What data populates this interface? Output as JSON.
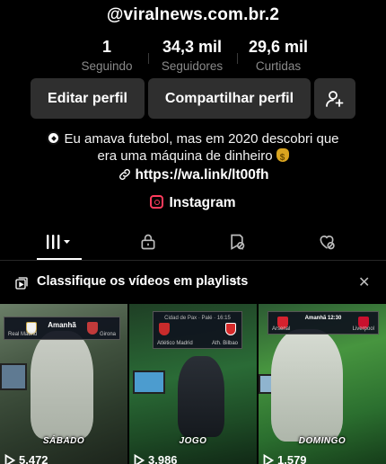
{
  "profile": {
    "username": "@viralnews.com.br.2"
  },
  "stats": [
    {
      "value": "1",
      "label": "Seguindo"
    },
    {
      "value": "34,3 mil",
      "label": "Seguidores"
    },
    {
      "value": "29,6 mil",
      "label": "Curtidas"
    }
  ],
  "actions": {
    "edit_label": "Editar perfil",
    "share_label": "Compartilhar perfil",
    "add_friend_icon": "add-user-icon"
  },
  "bio": {
    "line1": "Eu amava futebol, mas em 2020 descobri que",
    "line2": "era uma máquina de dinheiro",
    "link": "https://wa.link/lt00fh",
    "instagram_label": "Instagram"
  },
  "tabs": [
    {
      "name": "videos",
      "icon": "grid-icon",
      "active": true
    },
    {
      "name": "private",
      "icon": "lock-icon",
      "active": false
    },
    {
      "name": "favorites",
      "icon": "bookmark-hidden-icon",
      "active": false
    },
    {
      "name": "liked",
      "icon": "heart-hidden-icon",
      "active": false
    }
  ],
  "playlist_banner": {
    "text": "Classifique os vídeos em playlists"
  },
  "videos": [
    {
      "caption": "SÁBADO",
      "views": "5.472",
      "scoreboard": {
        "center": "Amanhã",
        "left": "Real Madrid",
        "right": "Girona"
      }
    },
    {
      "caption": "JOGO",
      "views": "3.986",
      "scoreboard": {
        "center": "Cidad de Pax · Palé · 16:15",
        "left": "Atlético Madrid",
        "right": "Ath. Bilbao"
      }
    },
    {
      "caption": "DOMINGO",
      "views": "1.579",
      "scoreboard": {
        "center": "Amanhã 12:30",
        "left": "Arsenal",
        "right": "Liverpool"
      }
    }
  ],
  "colors": {
    "background": "#000000",
    "button_bg": "#2f2f2f",
    "muted_text": "#8a8a8a",
    "instagram_accent": "#ff3b5c"
  }
}
